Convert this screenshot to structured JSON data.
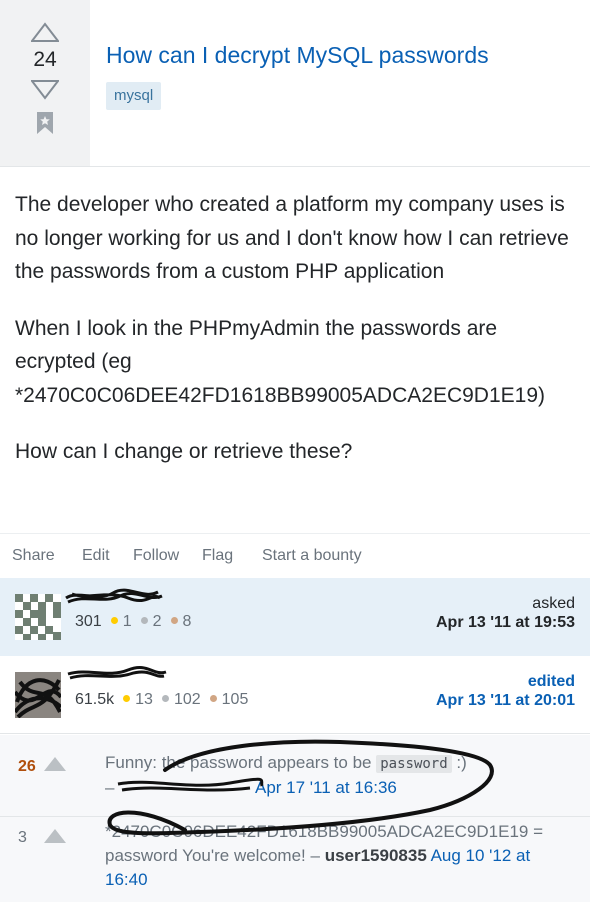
{
  "question": {
    "score": "24",
    "title": "How can I decrypt MySQL passwords",
    "tags": [
      "mysql"
    ],
    "body": [
      "The developer who created a platform my company uses is no longer working for us and I don't know how I can retrieve the passwords from a custom PHP application",
      "When I look in the PHPmyAdmin the passwords are ecrypted (eg *2470C0C06DEE42FD1618BB99005ADCA2EC9D1E19)",
      "How can I change or retrieve these?"
    ]
  },
  "actions": {
    "share": "Share",
    "edit": "Edit",
    "follow": "Follow",
    "flag": "Flag",
    "bounty": "Start a bounty"
  },
  "asked": {
    "label": "asked",
    "time": "Apr 13 '11 at 19:53",
    "rep": "301",
    "gold": "1",
    "silver": "2",
    "bronze": "8"
  },
  "edited": {
    "label": "edited",
    "time": "Apr 13 '11 at 20:01",
    "rep": "61.5k",
    "gold": "13",
    "silver": "102",
    "bronze": "105"
  },
  "comments": [
    {
      "score": "26",
      "text_before": "Funny: the password appears to be",
      "code": "password",
      "text_after": ":)",
      "separator": "–",
      "time": "Apr 17 '11 at 16:36"
    },
    {
      "score": "3",
      "text": "*2470C0C06DEE42FD1618BB99005ADCA2EC9D1E19 = password You're welcome!",
      "separator": "–",
      "user": "user1590835",
      "time": "Aug 10 '12 at 16:40"
    }
  ],
  "colors": {
    "link": "#0a60b4",
    "tag_bg": "#e1ecf4",
    "asked_bg": "#e6f0f8",
    "comment_score_hot": "#b04f0c",
    "gold_badge": "#ffcc01",
    "silver_badge": "#b4b8bc",
    "bronze_badge": "#d1a684"
  }
}
